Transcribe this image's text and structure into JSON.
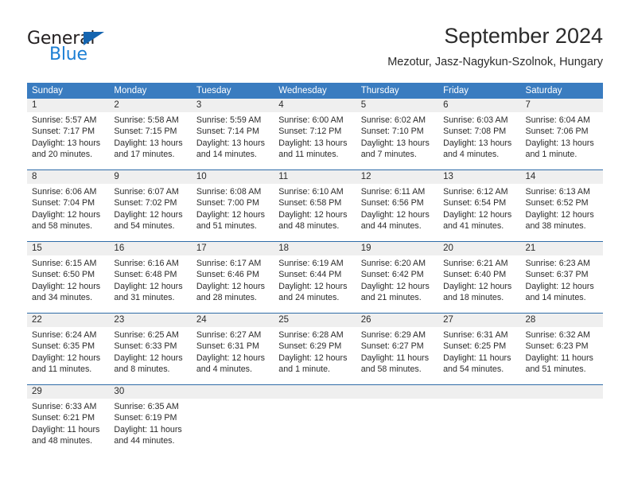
{
  "logo": {
    "word1": "General",
    "word2": "Blue",
    "triangle_color": "#1565b0",
    "blue_color": "#1c7fd4"
  },
  "header": {
    "title": "September 2024",
    "subtitle": "Mezotur, Jasz-Nagykun-Szolnok, Hungary"
  },
  "theme": {
    "header_bg": "#3a7cc0",
    "week_rule": "#2f6ca8",
    "daynum_bg": "#efefef",
    "text": "#2b2b2b"
  },
  "calendar": {
    "weekdays": [
      "Sunday",
      "Monday",
      "Tuesday",
      "Wednesday",
      "Thursday",
      "Friday",
      "Saturday"
    ],
    "weeks": [
      [
        {
          "day": "1",
          "sunrise": "Sunrise: 5:57 AM",
          "sunset": "Sunset: 7:17 PM",
          "daylight1": "Daylight: 13 hours",
          "daylight2": "and 20 minutes."
        },
        {
          "day": "2",
          "sunrise": "Sunrise: 5:58 AM",
          "sunset": "Sunset: 7:15 PM",
          "daylight1": "Daylight: 13 hours",
          "daylight2": "and 17 minutes."
        },
        {
          "day": "3",
          "sunrise": "Sunrise: 5:59 AM",
          "sunset": "Sunset: 7:14 PM",
          "daylight1": "Daylight: 13 hours",
          "daylight2": "and 14 minutes."
        },
        {
          "day": "4",
          "sunrise": "Sunrise: 6:00 AM",
          "sunset": "Sunset: 7:12 PM",
          "daylight1": "Daylight: 13 hours",
          "daylight2": "and 11 minutes."
        },
        {
          "day": "5",
          "sunrise": "Sunrise: 6:02 AM",
          "sunset": "Sunset: 7:10 PM",
          "daylight1": "Daylight: 13 hours",
          "daylight2": "and 7 minutes."
        },
        {
          "day": "6",
          "sunrise": "Sunrise: 6:03 AM",
          "sunset": "Sunset: 7:08 PM",
          "daylight1": "Daylight: 13 hours",
          "daylight2": "and 4 minutes."
        },
        {
          "day": "7",
          "sunrise": "Sunrise: 6:04 AM",
          "sunset": "Sunset: 7:06 PM",
          "daylight1": "Daylight: 13 hours",
          "daylight2": "and 1 minute."
        }
      ],
      [
        {
          "day": "8",
          "sunrise": "Sunrise: 6:06 AM",
          "sunset": "Sunset: 7:04 PM",
          "daylight1": "Daylight: 12 hours",
          "daylight2": "and 58 minutes."
        },
        {
          "day": "9",
          "sunrise": "Sunrise: 6:07 AM",
          "sunset": "Sunset: 7:02 PM",
          "daylight1": "Daylight: 12 hours",
          "daylight2": "and 54 minutes."
        },
        {
          "day": "10",
          "sunrise": "Sunrise: 6:08 AM",
          "sunset": "Sunset: 7:00 PM",
          "daylight1": "Daylight: 12 hours",
          "daylight2": "and 51 minutes."
        },
        {
          "day": "11",
          "sunrise": "Sunrise: 6:10 AM",
          "sunset": "Sunset: 6:58 PM",
          "daylight1": "Daylight: 12 hours",
          "daylight2": "and 48 minutes."
        },
        {
          "day": "12",
          "sunrise": "Sunrise: 6:11 AM",
          "sunset": "Sunset: 6:56 PM",
          "daylight1": "Daylight: 12 hours",
          "daylight2": "and 44 minutes."
        },
        {
          "day": "13",
          "sunrise": "Sunrise: 6:12 AM",
          "sunset": "Sunset: 6:54 PM",
          "daylight1": "Daylight: 12 hours",
          "daylight2": "and 41 minutes."
        },
        {
          "day": "14",
          "sunrise": "Sunrise: 6:13 AM",
          "sunset": "Sunset: 6:52 PM",
          "daylight1": "Daylight: 12 hours",
          "daylight2": "and 38 minutes."
        }
      ],
      [
        {
          "day": "15",
          "sunrise": "Sunrise: 6:15 AM",
          "sunset": "Sunset: 6:50 PM",
          "daylight1": "Daylight: 12 hours",
          "daylight2": "and 34 minutes."
        },
        {
          "day": "16",
          "sunrise": "Sunrise: 6:16 AM",
          "sunset": "Sunset: 6:48 PM",
          "daylight1": "Daylight: 12 hours",
          "daylight2": "and 31 minutes."
        },
        {
          "day": "17",
          "sunrise": "Sunrise: 6:17 AM",
          "sunset": "Sunset: 6:46 PM",
          "daylight1": "Daylight: 12 hours",
          "daylight2": "and 28 minutes."
        },
        {
          "day": "18",
          "sunrise": "Sunrise: 6:19 AM",
          "sunset": "Sunset: 6:44 PM",
          "daylight1": "Daylight: 12 hours",
          "daylight2": "and 24 minutes."
        },
        {
          "day": "19",
          "sunrise": "Sunrise: 6:20 AM",
          "sunset": "Sunset: 6:42 PM",
          "daylight1": "Daylight: 12 hours",
          "daylight2": "and 21 minutes."
        },
        {
          "day": "20",
          "sunrise": "Sunrise: 6:21 AM",
          "sunset": "Sunset: 6:40 PM",
          "daylight1": "Daylight: 12 hours",
          "daylight2": "and 18 minutes."
        },
        {
          "day": "21",
          "sunrise": "Sunrise: 6:23 AM",
          "sunset": "Sunset: 6:37 PM",
          "daylight1": "Daylight: 12 hours",
          "daylight2": "and 14 minutes."
        }
      ],
      [
        {
          "day": "22",
          "sunrise": "Sunrise: 6:24 AM",
          "sunset": "Sunset: 6:35 PM",
          "daylight1": "Daylight: 12 hours",
          "daylight2": "and 11 minutes."
        },
        {
          "day": "23",
          "sunrise": "Sunrise: 6:25 AM",
          "sunset": "Sunset: 6:33 PM",
          "daylight1": "Daylight: 12 hours",
          "daylight2": "and 8 minutes."
        },
        {
          "day": "24",
          "sunrise": "Sunrise: 6:27 AM",
          "sunset": "Sunset: 6:31 PM",
          "daylight1": "Daylight: 12 hours",
          "daylight2": "and 4 minutes."
        },
        {
          "day": "25",
          "sunrise": "Sunrise: 6:28 AM",
          "sunset": "Sunset: 6:29 PM",
          "daylight1": "Daylight: 12 hours",
          "daylight2": "and 1 minute."
        },
        {
          "day": "26",
          "sunrise": "Sunrise: 6:29 AM",
          "sunset": "Sunset: 6:27 PM",
          "daylight1": "Daylight: 11 hours",
          "daylight2": "and 58 minutes."
        },
        {
          "day": "27",
          "sunrise": "Sunrise: 6:31 AM",
          "sunset": "Sunset: 6:25 PM",
          "daylight1": "Daylight: 11 hours",
          "daylight2": "and 54 minutes."
        },
        {
          "day": "28",
          "sunrise": "Sunrise: 6:32 AM",
          "sunset": "Sunset: 6:23 PM",
          "daylight1": "Daylight: 11 hours",
          "daylight2": "and 51 minutes."
        }
      ],
      [
        {
          "day": "29",
          "sunrise": "Sunrise: 6:33 AM",
          "sunset": "Sunset: 6:21 PM",
          "daylight1": "Daylight: 11 hours",
          "daylight2": "and 48 minutes."
        },
        {
          "day": "30",
          "sunrise": "Sunrise: 6:35 AM",
          "sunset": "Sunset: 6:19 PM",
          "daylight1": "Daylight: 11 hours",
          "daylight2": "and 44 minutes."
        },
        {
          "day": "",
          "sunrise": "",
          "sunset": "",
          "daylight1": "",
          "daylight2": ""
        },
        {
          "day": "",
          "sunrise": "",
          "sunset": "",
          "daylight1": "",
          "daylight2": ""
        },
        {
          "day": "",
          "sunrise": "",
          "sunset": "",
          "daylight1": "",
          "daylight2": ""
        },
        {
          "day": "",
          "sunrise": "",
          "sunset": "",
          "daylight1": "",
          "daylight2": ""
        },
        {
          "day": "",
          "sunrise": "",
          "sunset": "",
          "daylight1": "",
          "daylight2": ""
        }
      ]
    ]
  }
}
